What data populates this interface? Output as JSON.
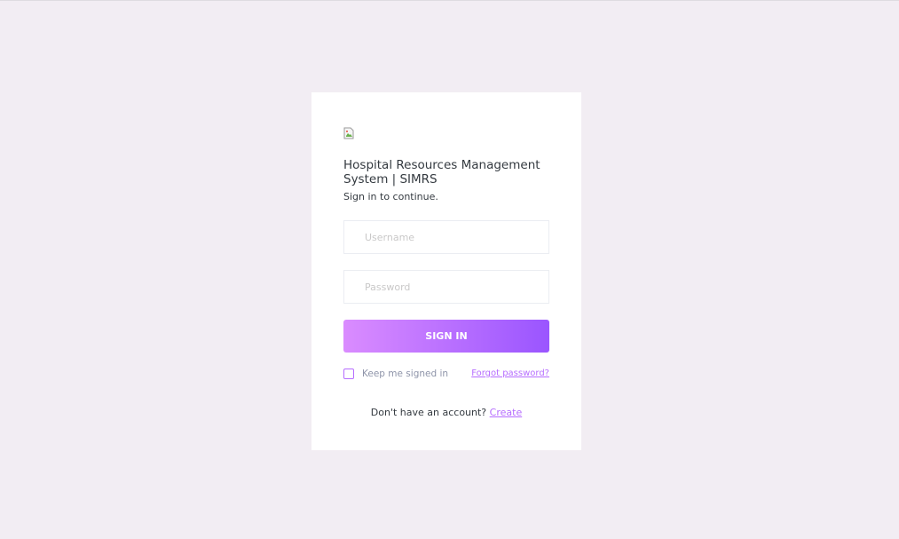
{
  "app": {
    "title": "Hospital Resources Management System | SIMRS",
    "subtitle": "Sign in to continue."
  },
  "login": {
    "username_placeholder": "Username",
    "password_placeholder": "Password",
    "signin_label": "SIGN IN",
    "keep_signed_in_label": "Keep me signed in",
    "forgot_password_label": "Forgot password?",
    "no_account_text": "Don't have an account?",
    "create_label": "Create"
  },
  "icons": {
    "logo": "broken-image-icon"
  },
  "colors": {
    "background": "#f2edf3",
    "accent": "#b66dff",
    "gradient_start": "#da8cff",
    "gradient_end": "#9a55ff"
  }
}
